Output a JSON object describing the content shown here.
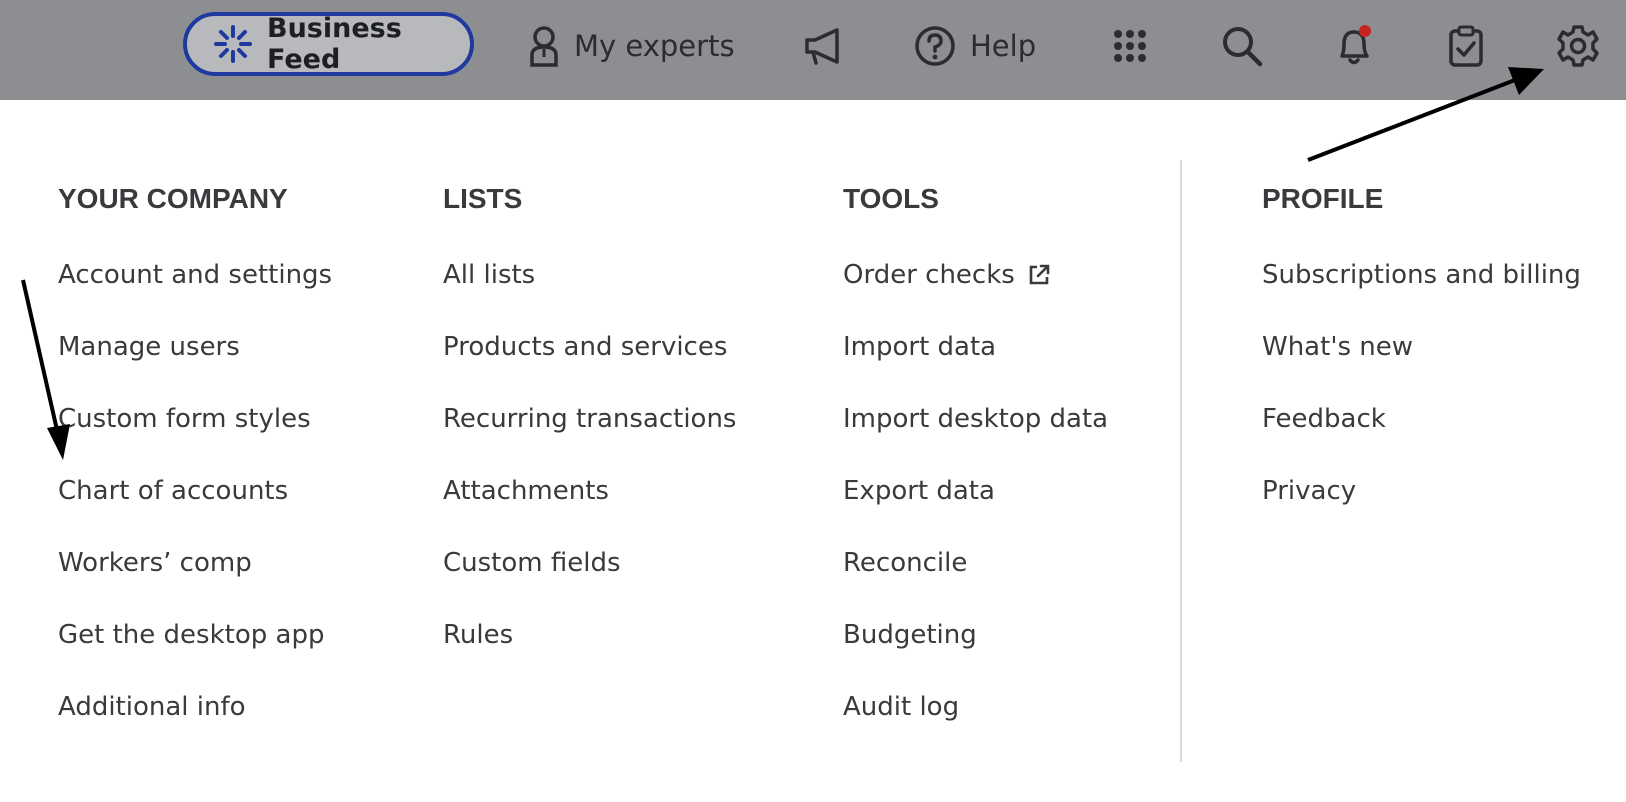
{
  "topbar": {
    "business_feed": "Business Feed",
    "my_experts": "My experts",
    "help": "Help",
    "icons": [
      "sparkle-icon",
      "expert-icon",
      "megaphone-icon",
      "help-icon",
      "apps-grid-icon",
      "search-icon",
      "bell-icon",
      "clipboard-check-icon",
      "gear-icon"
    ],
    "colors": {
      "bar": "#8d8e91",
      "pill_border": "#1e3a9e",
      "notification_dot": "#c4261d"
    }
  },
  "menu": {
    "your_company": {
      "title": "YOUR COMPANY",
      "items": [
        "Account and settings",
        "Manage users",
        "Custom form styles",
        "Chart of accounts",
        "Workers’ comp",
        "Get the desktop app",
        "Additional info"
      ]
    },
    "lists": {
      "title": "LISTS",
      "items": [
        "All lists",
        "Products and services",
        "Recurring transactions",
        "Attachments",
        "Custom fields",
        "Rules"
      ]
    },
    "tools": {
      "title": "TOOLS",
      "items": [
        "Order checks",
        "Import data",
        "Import desktop data",
        "Export data",
        "Reconcile",
        "Budgeting",
        "Audit log"
      ]
    },
    "profile": {
      "title": "PROFILE",
      "items": [
        "Subscriptions and billing",
        "What's new",
        "Feedback",
        "Privacy"
      ]
    }
  },
  "annotations": [
    "arrow-to-gear",
    "arrow-to-chart-of-accounts"
  ]
}
